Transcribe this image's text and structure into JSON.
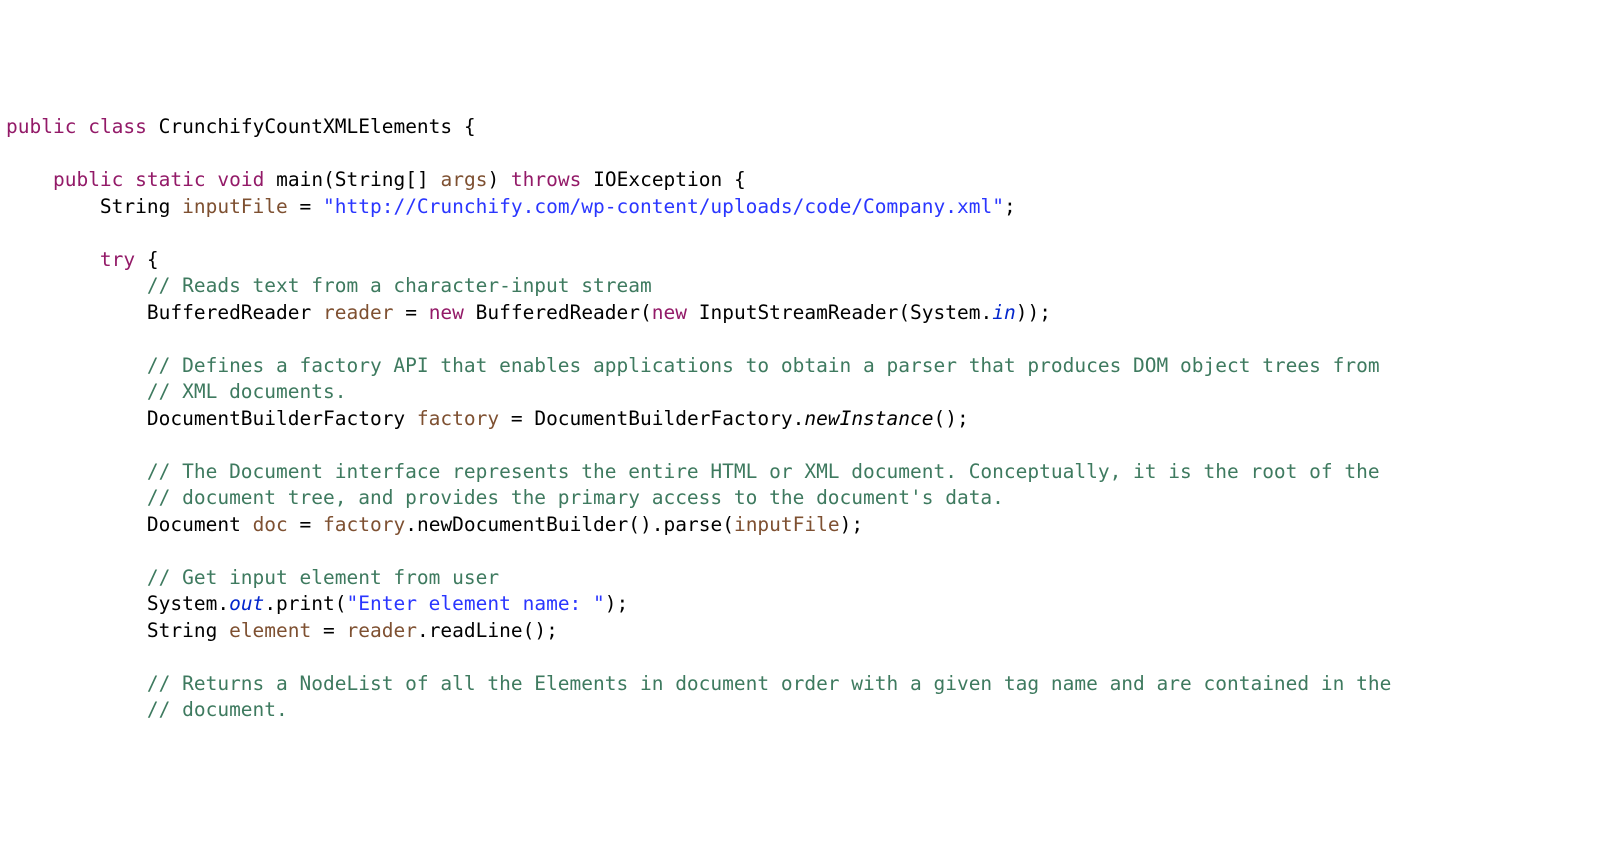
{
  "l1": {
    "kw1": "public",
    "kw2": "class",
    "name": "CrunchifyCountXMLElements",
    "ob": " {"
  },
  "l2": {
    "pad": "    ",
    "kw1": "public",
    "kw2": "static",
    "kw3": "void",
    "mname": "main",
    "op": "(String[] ",
    "arg": "args",
    "cp": ")",
    "kw4": " throws",
    "ex": " IOException {"
  },
  "l3": {
    "pad": "        ",
    "t1": "String ",
    "var": "inputFile",
    "t2": " = ",
    "str": "\"http://Crunchify.com/wp-content/uploads/code/Company.xml\"",
    "semi": ";"
  },
  "l4": {
    "pad": "        ",
    "kw": "try",
    "ob": " {"
  },
  "l5": {
    "pad": "            ",
    "c": "// Reads text from a character-input stream"
  },
  "l6": {
    "pad": "            ",
    "t1": "BufferedReader ",
    "var": "reader",
    "t2": " = ",
    "kw1": "new",
    "t3": " BufferedReader(",
    "kw2": "new",
    "t4": " InputStreamReader(System.",
    "stat": "in",
    "t5": "));"
  },
  "l7": {
    "pad": "            ",
    "c": "// Defines a factory API that enables applications to obtain a parser that produces DOM object trees from"
  },
  "l8": {
    "pad": "            ",
    "c": "// XML documents."
  },
  "l9": {
    "pad": "            ",
    "t1": "DocumentBuilderFactory ",
    "var": "factory",
    "t2": " = DocumentBuilderFactory.",
    "call": "newInstance",
    "t3": "();"
  },
  "l10": {
    "pad": "            ",
    "c": "// The Document interface represents the entire HTML or XML document. Conceptually, it is the root of the"
  },
  "l11": {
    "pad": "            ",
    "c": "// document tree, and provides the primary access to the document's data."
  },
  "l12": {
    "pad": "            ",
    "t1": "Document ",
    "var": "doc",
    "t2": " = ",
    "ref": "factory",
    "t3": ".newDocumentBuilder().parse(",
    "ref2": "inputFile",
    "t4": ");"
  },
  "l13": {
    "pad": "            ",
    "c": "// Get input element from user"
  },
  "l14": {
    "pad": "            ",
    "t1": "System.",
    "stat": "out",
    "t2": ".print(",
    "str": "\"Enter element name: \"",
    "t3": ");"
  },
  "l15": {
    "pad": "            ",
    "t1": "String ",
    "var": "element",
    "t2": " = ",
    "ref": "reader",
    "t3": ".readLine();"
  },
  "l16": {
    "pad": "            ",
    "c": "// Returns a NodeList of all the Elements in document order with a given tag name and are contained in the"
  },
  "l17": {
    "pad": "            ",
    "c": "// document."
  }
}
